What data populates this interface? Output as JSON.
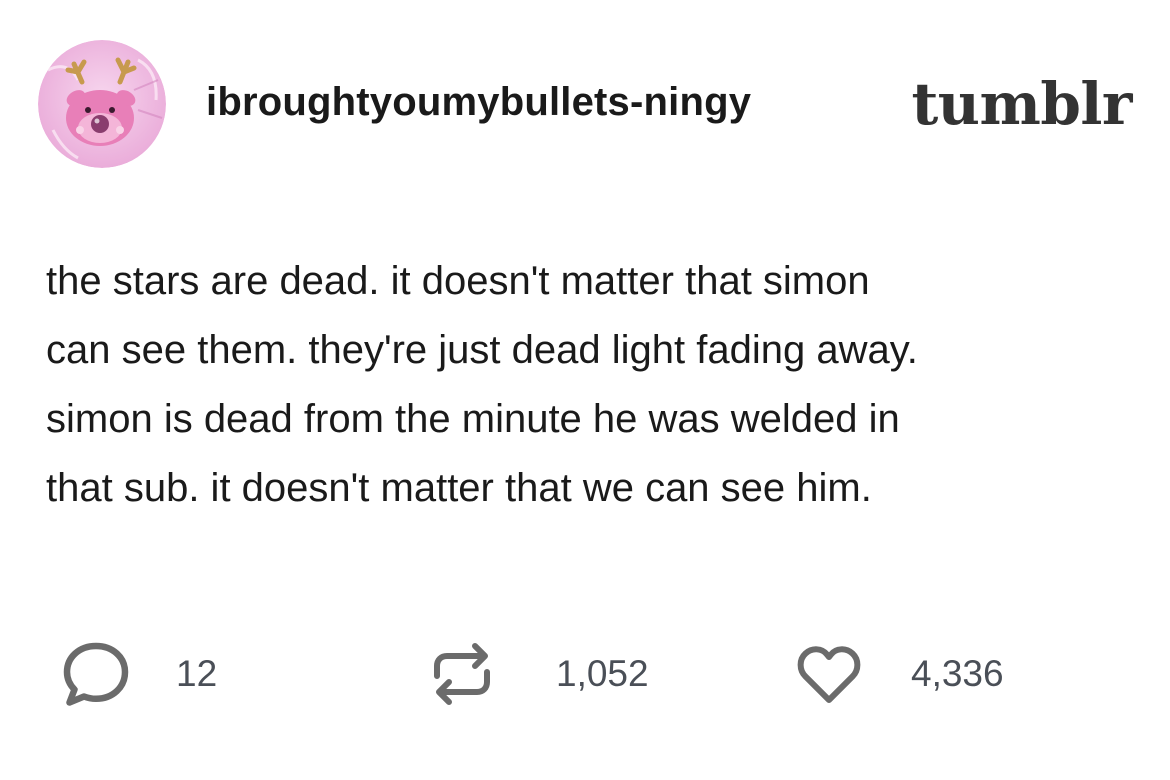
{
  "post": {
    "username": "ibroughtyoumybullets-ningy",
    "brand": "tumblr",
    "text_lines": [
      "the stars are dead. it doesn't matter that simon",
      "can see them. they're just dead light fading away.",
      "simon is dead from the minute he was welded in",
      "that sub. it doesn't matter that we can see him."
    ]
  },
  "actions": {
    "comments": {
      "icon": "comment-bubble-icon",
      "count": "12"
    },
    "reblogs": {
      "icon": "reblog-icon",
      "count": "1,052"
    },
    "likes": {
      "icon": "heart-icon",
      "count": "4,336"
    }
  },
  "colors": {
    "text": "#1a1a1a",
    "brand": "#333333",
    "count": "#4a4f57",
    "icon": "#6b6b6b",
    "avatar_bg": "#f2c9e6"
  }
}
